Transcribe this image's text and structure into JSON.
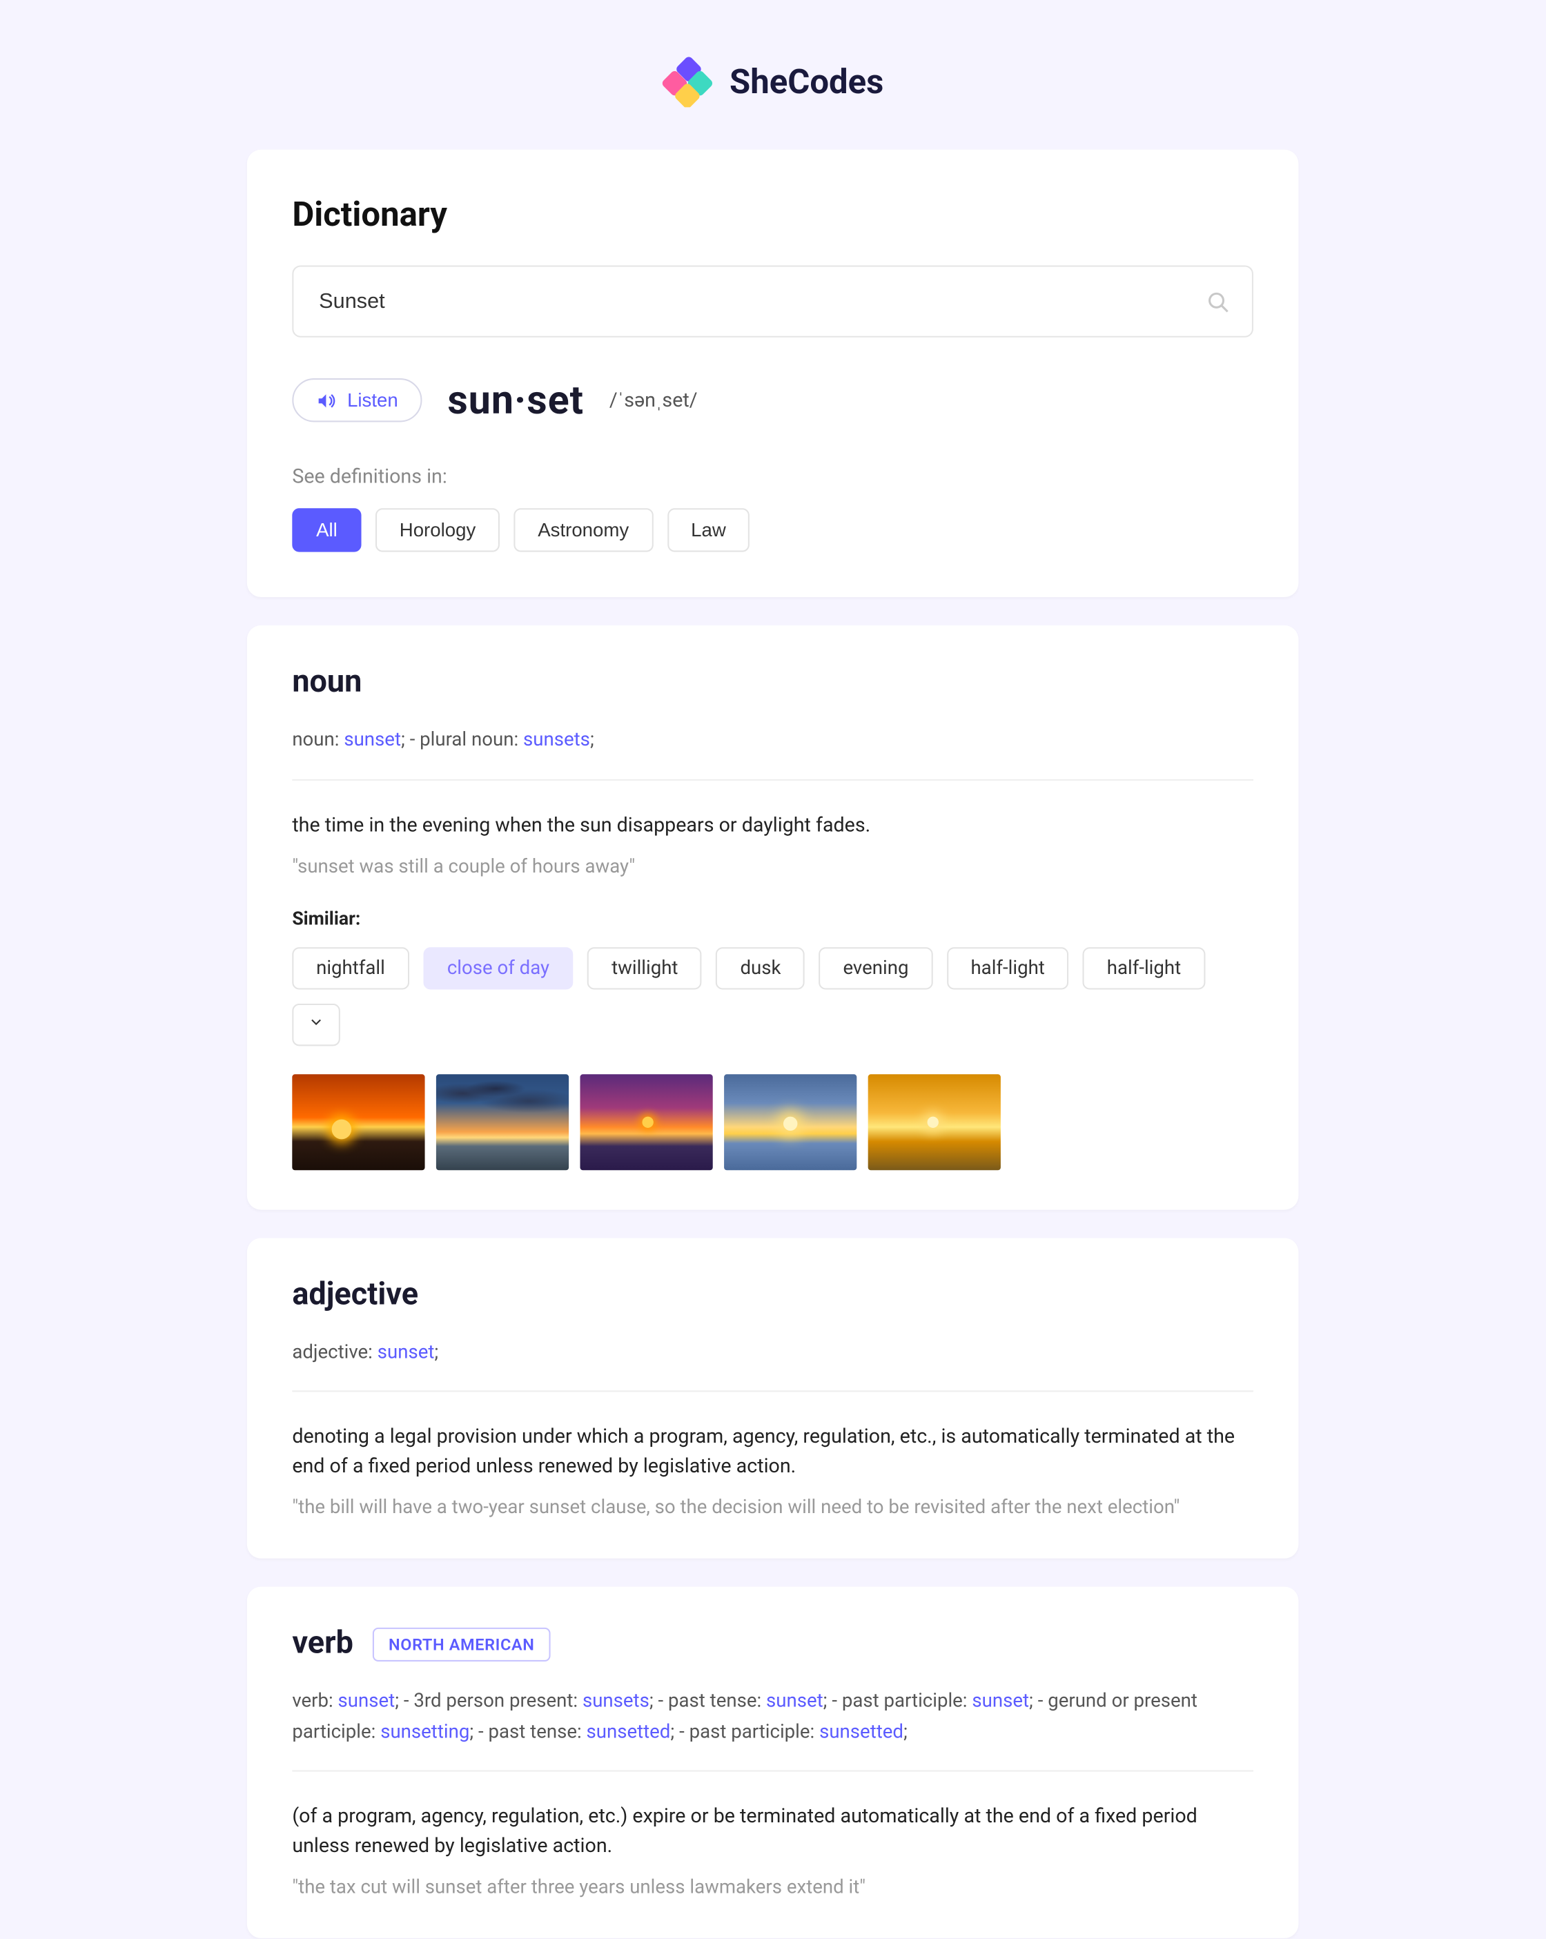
{
  "brand": "SheCodes",
  "title": "Dictionary",
  "search": {
    "value": "Sunset"
  },
  "listen_label": "Listen",
  "syllables": "sun·set",
  "phonetic": "/ˈsənˌset/",
  "see_definitions_label": "See definitions in:",
  "categories": [
    "All",
    "Horology",
    "Astronomy",
    "Law"
  ],
  "active_category": "All",
  "noun": {
    "heading": "noun",
    "forms_prefix_1": "noun:",
    "form_1": "sunset",
    "forms_sep_1": ";   -   plural noun:",
    "form_2": "sunsets",
    "forms_suffix": ";",
    "definition": "the time in the evening when the sun disappears or daylight fades.",
    "example": "\"sunset was still a couple of hours away\"",
    "similar_label": "Similiar:",
    "similar": [
      "nightfall",
      "close of day",
      "twillight",
      "dusk",
      "evening",
      "half-light",
      "half-light"
    ],
    "similar_highlight_index": 1
  },
  "adjective": {
    "heading": "adjective",
    "forms_prefix": "adjective:",
    "form": "sunset",
    "forms_suffix": ";",
    "definition": "denoting a legal provision under which a program, agency, regulation, etc., is automatically terminated at the end of a fixed period unless renewed by legislative action.",
    "example": "\"the bill will have a two-year sunset clause, so the decision will need to be revisited after the next election\""
  },
  "verb": {
    "heading": "verb",
    "tag": "NORTH AMERICAN",
    "forms_parts": [
      {
        "label": "verb:",
        "word": "sunset"
      },
      {
        "label": "3rd person present:",
        "word": "sunsets"
      },
      {
        "label": "past tense:",
        "word": "sunset"
      },
      {
        "label": "past participle:",
        "word": "sunset"
      },
      {
        "label": "gerund or present participle:",
        "word": "sunsetting"
      },
      {
        "label": "past tense:",
        "word": "sunsetted"
      },
      {
        "label": "past participle:",
        "word": "sunsetted"
      }
    ],
    "definition": "(of a program, agency, regulation, etc.) expire or be terminated automatically at the end of a fixed period unless renewed by legislative action.",
    "example": "\"the tax cut will sunset after three years unless lawmakers extend it\""
  }
}
